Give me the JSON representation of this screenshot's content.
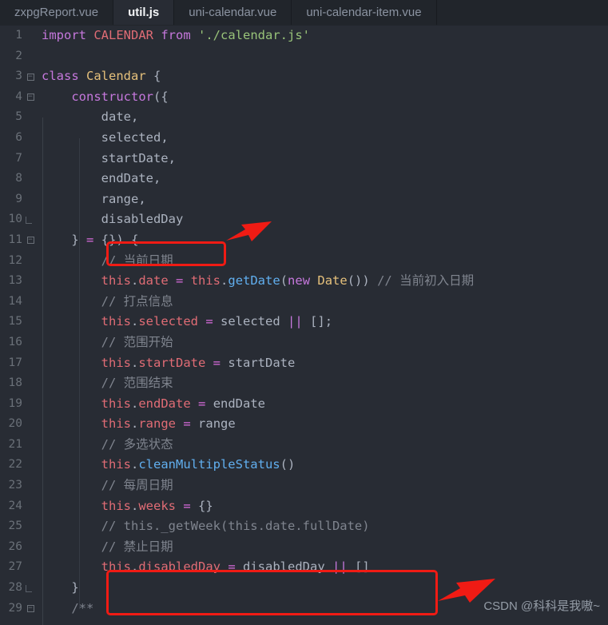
{
  "window": {
    "app": "code-editor",
    "theme_name": "one-dark",
    "colors": {
      "editor_background": "#282c34",
      "tabbar_background": "#21252b",
      "gutter_text": "#6a7078",
      "default_text": "#abb2bf",
      "comment": "#7f848e",
      "keyword": "#c678dd",
      "class_name": "#e5c07b",
      "constant": "#e06c75",
      "string": "#98c379",
      "method": "#61afef",
      "operator": "#d96bdd",
      "annotation_red": "#f01b14"
    }
  },
  "tabs": [
    {
      "label": "zxpgReport.vue",
      "active": false
    },
    {
      "label": "util.js",
      "active": true
    },
    {
      "label": "uni-calendar.vue",
      "active": false
    },
    {
      "label": "uni-calendar-item.vue",
      "active": false
    }
  ],
  "code": {
    "language": "javascript",
    "first_line": 1,
    "last_line": 29,
    "lines": [
      {
        "n": "1",
        "fold": "",
        "text": "import CALENDAR from './calendar.js'"
      },
      {
        "n": "2",
        "fold": "",
        "text": ""
      },
      {
        "n": "3",
        "fold": "box",
        "text": "class Calendar {"
      },
      {
        "n": "4",
        "fold": "box",
        "text": "    constructor({"
      },
      {
        "n": "5",
        "fold": "",
        "text": "        date,"
      },
      {
        "n": "6",
        "fold": "",
        "text": "        selected,"
      },
      {
        "n": "7",
        "fold": "",
        "text": "        startDate,"
      },
      {
        "n": "8",
        "fold": "",
        "text": "        endDate,"
      },
      {
        "n": "9",
        "fold": "",
        "text": "        range,"
      },
      {
        "n": "10",
        "fold": "end",
        "text": "        disabledDay"
      },
      {
        "n": "11",
        "fold": "box",
        "text": "    } = {}) {"
      },
      {
        "n": "12",
        "fold": "",
        "text": "        // 当前日期"
      },
      {
        "n": "13",
        "fold": "",
        "text": "        this.date = this.getDate(new Date()) // 当前初入日期"
      },
      {
        "n": "14",
        "fold": "",
        "text": "        // 打点信息"
      },
      {
        "n": "15",
        "fold": "",
        "text": "        this.selected = selected || [];"
      },
      {
        "n": "16",
        "fold": "",
        "text": "        // 范围开始"
      },
      {
        "n": "17",
        "fold": "",
        "text": "        this.startDate = startDate"
      },
      {
        "n": "18",
        "fold": "",
        "text": "        // 范围结束"
      },
      {
        "n": "19",
        "fold": "",
        "text": "        this.endDate = endDate"
      },
      {
        "n": "20",
        "fold": "",
        "text": "        this.range = range"
      },
      {
        "n": "21",
        "fold": "",
        "text": "        // 多选状态"
      },
      {
        "n": "22",
        "fold": "",
        "text": "        this.cleanMultipleStatus()"
      },
      {
        "n": "23",
        "fold": "",
        "text": "        // 每周日期"
      },
      {
        "n": "24",
        "fold": "",
        "text": "        this.weeks = {}"
      },
      {
        "n": "25",
        "fold": "",
        "text": "        // this._getWeek(this.date.fullDate)"
      },
      {
        "n": "26",
        "fold": "",
        "text": "        // 禁止日期"
      },
      {
        "n": "27",
        "fold": "",
        "text": "        this.disabledDay = disabledDay || []"
      },
      {
        "n": "28",
        "fold": "end",
        "text": "    }"
      },
      {
        "n": "29",
        "fold": "box",
        "text": "    /**"
      }
    ]
  },
  "annotations": {
    "boxes": [
      {
        "id": "redbox-1",
        "target_line": "10",
        "encloses": "disabledDay"
      },
      {
        "id": "redbox-2",
        "target_lines": "26-27",
        "encloses": "// 禁止日期 / this.disabledDay = disabledDay || []"
      }
    ],
    "arrows": [
      {
        "id": "arrow-1",
        "points_to": "disabledDay on line 10"
      },
      {
        "id": "arrow-2",
        "points_to": "this.disabledDay assignment on line 27"
      }
    ]
  },
  "watermark": {
    "text": "CSDN @科科是我嗷~"
  }
}
